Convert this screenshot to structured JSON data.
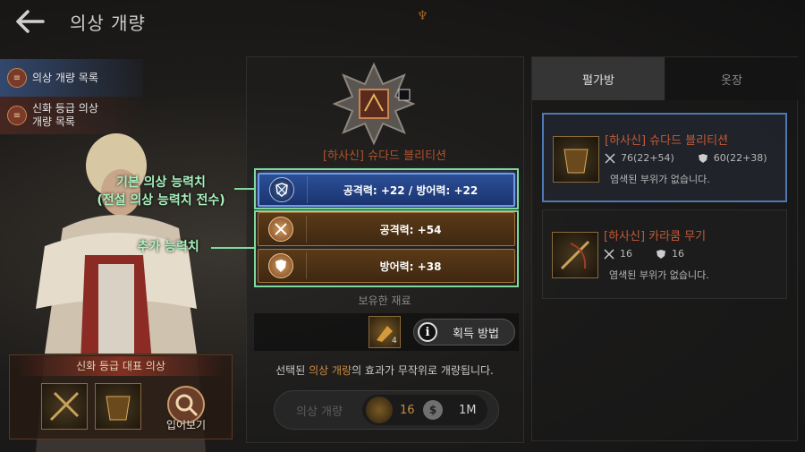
{
  "header": {
    "title": "의상 개량"
  },
  "left_menu": {
    "items": [
      {
        "icon": "list-icon",
        "label": "의상 개량 목록"
      },
      {
        "icon": "list-icon",
        "label_line1": "신화 등급 의상",
        "label_line2": "개량 목록"
      }
    ]
  },
  "representative": {
    "title": "신화 등급 대표 의상",
    "view_label": "입어보기"
  },
  "center": {
    "item_name": "[하사신] 슈다드 블리티션",
    "stats": {
      "base_value": "공격력: +22 / 방어력: +22",
      "attack_bonus": "공격력: +54",
      "defense_bonus": "방어력: +38"
    },
    "annotations": {
      "base_label_line1": "기본 의상 능력치",
      "base_label_line2": "(전설 의상 능력치 전수)",
      "bonus_label": "추가 능력치"
    },
    "materials": {
      "label": "보유한 재료",
      "count": "4",
      "howto_label": "획득 방법"
    },
    "notice": {
      "prefix": "선택된 ",
      "highlight": "의상 개량",
      "suffix": "의 효과가 무작위로 개량됩니다."
    },
    "action": {
      "label": "의상 개량",
      "material_cost": "16",
      "silver_cost": "1M"
    }
  },
  "right": {
    "tabs": [
      "펄가방",
      "옷장"
    ],
    "cards": [
      {
        "name": "[하사신] 슈다드 블리티션",
        "attack": "76(22+54)",
        "defense": "60(22+38)",
        "desc": "염색된 부위가 없습니다."
      },
      {
        "name": "[하사신] 카라쿰 무기",
        "attack": "16",
        "defense": "16",
        "desc": "염색된 부위가 없습니다."
      }
    ]
  },
  "colors": {
    "accent_blue": "#2b4f97",
    "bonus_brown": "#5a3a17",
    "annotation_green": "#7ed99a",
    "item_name_red": "#c45a35",
    "highlight_orange": "#d08b3f"
  }
}
